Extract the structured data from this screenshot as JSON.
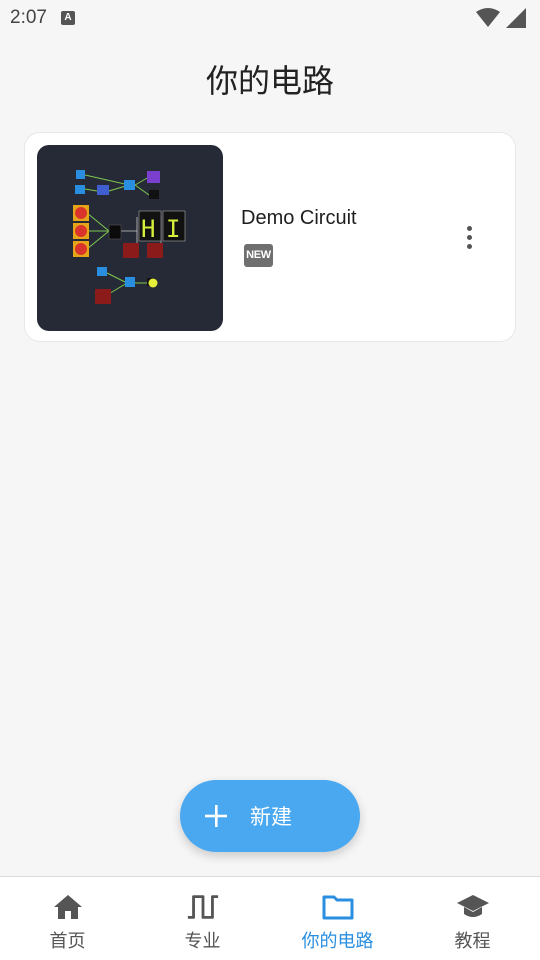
{
  "status_bar": {
    "time": "2:07",
    "notification_letter": "A"
  },
  "page": {
    "title": "你的电路"
  },
  "circuit_card": {
    "name": "Demo Circuit",
    "badge": "NEW",
    "thumbnail_display_text": "H I"
  },
  "fab": {
    "label": "新建"
  },
  "bottom_nav": {
    "items": [
      {
        "label": "首页",
        "icon": "home-icon",
        "active": false
      },
      {
        "label": "专业",
        "icon": "waveform-icon",
        "active": false
      },
      {
        "label": "你的电路",
        "icon": "folder-icon",
        "active": true
      },
      {
        "label": "教程",
        "icon": "graduation-cap-icon",
        "active": false
      }
    ]
  },
  "colors": {
    "accent": "#2a8fe0",
    "fab": "#4aa8f0",
    "background": "#f6f6f6",
    "thumbnail_bg": "#262a36"
  }
}
